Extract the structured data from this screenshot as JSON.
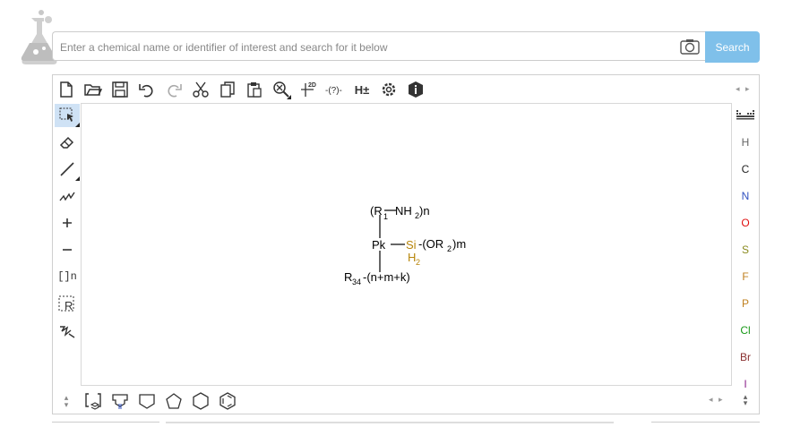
{
  "search": {
    "placeholder": "Enter a chemical name or identifier of interest and search for it below",
    "button_label": "Search"
  },
  "toolbar": {
    "tools": [
      "new-document",
      "open",
      "save",
      "undo",
      "redo",
      "cut",
      "copy",
      "paste",
      "zoom",
      "layout-2d",
      "check-structure",
      "add-remove-hydrogens",
      "settings",
      "about"
    ],
    "layout_label": "2D",
    "hydrogens_label": "H±",
    "check_label": "-(?)-"
  },
  "left_tools": [
    "select",
    "erase",
    "bond",
    "chain",
    "charge-plus",
    "charge-minus",
    "sgroup",
    "rgroup",
    "reaction-mapping"
  ],
  "sgroup_label": "[]n",
  "rgroup_label": "R",
  "elements": [
    {
      "symbol": "H",
      "color": "#666666"
    },
    {
      "symbol": "C",
      "color": "#222222"
    },
    {
      "symbol": "N",
      "color": "#3050c0"
    },
    {
      "symbol": "O",
      "color": "#e01010"
    },
    {
      "symbol": "S",
      "color": "#8a8a1e"
    },
    {
      "symbol": "F",
      "color": "#c08020"
    },
    {
      "symbol": "P",
      "color": "#c08020"
    },
    {
      "symbol": "Cl",
      "color": "#1a9a1a"
    },
    {
      "symbol": "Br",
      "color": "#8a3030"
    },
    {
      "symbol": "I",
      "color": "#8a208a"
    }
  ],
  "molecule": {
    "top_r": "(R",
    "top_sub": "1",
    "top_nh": "NH",
    "top_nh_sub": "2",
    "top_end": ")n",
    "center": "Pk",
    "si": "Si",
    "si_tail": "-(OR",
    "si_tail_sub": "2",
    "si_tail_end": ")m",
    "h2": "H",
    "h2_sub": "2",
    "bottom_r": "R",
    "bottom_sub": "34",
    "bottom_tail": "-(n+m+k)",
    "si_color": "#b8860b"
  },
  "bottom_shapes": [
    "template-library",
    "functional-groups",
    "shape-rectangle",
    "shape-pentagon",
    "shape-hexagon",
    "shape-benzene"
  ]
}
